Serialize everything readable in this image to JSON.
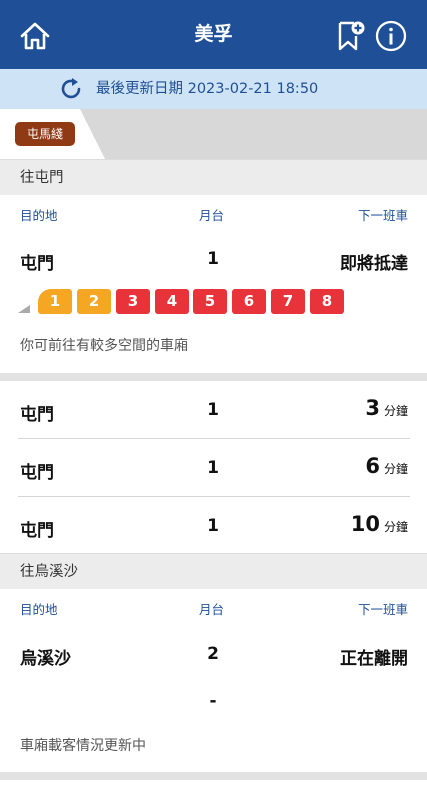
{
  "header": {
    "title": "美孚",
    "home_icon": "home-icon",
    "bookmark_icon": "bookmark-add-icon",
    "info_icon": "info-icon",
    "color": "#1f4f96"
  },
  "update_bar": {
    "text": "最後更新日期 2023-02-21 18:50",
    "icon": "refresh-icon"
  },
  "line_tab": {
    "label": "屯馬綫",
    "color": "#8f3a14"
  },
  "sections": [
    {
      "heading": "往屯門",
      "columns": {
        "destination": "目的地",
        "platform": "月台",
        "next": "下一班車"
      },
      "first_train": {
        "destination": "屯門",
        "platform": "1",
        "status": "即將抵達",
        "cars": [
          {
            "label": "1",
            "level": "low",
            "color": "#f5a623"
          },
          {
            "label": "2",
            "level": "low",
            "color": "#f5a623"
          },
          {
            "label": "3",
            "level": "high",
            "color": "#e8333a"
          },
          {
            "label": "4",
            "level": "high",
            "color": "#e8333a"
          },
          {
            "label": "5",
            "level": "high",
            "color": "#e8333a"
          },
          {
            "label": "6",
            "level": "high",
            "color": "#e8333a"
          },
          {
            "label": "7",
            "level": "high",
            "color": "#e8333a"
          },
          {
            "label": "8",
            "level": "high",
            "color": "#e8333a"
          }
        ],
        "hint": "你可前往有較多空間的車廂"
      },
      "upcoming": [
        {
          "destination": "屯門",
          "platform": "1",
          "minutes": "3",
          "unit": "分鐘"
        },
        {
          "destination": "屯門",
          "platform": "1",
          "minutes": "6",
          "unit": "分鐘"
        },
        {
          "destination": "屯門",
          "platform": "1",
          "minutes": "10",
          "unit": "分鐘"
        }
      ]
    },
    {
      "heading": "往烏溪沙",
      "columns": {
        "destination": "目的地",
        "platform": "月台",
        "next": "下一班車"
      },
      "first_train": {
        "destination": "烏溪沙",
        "platform": "2",
        "status": "正在離開",
        "placeholder": "-",
        "hint": "車廂載客情況更新中"
      }
    }
  ]
}
